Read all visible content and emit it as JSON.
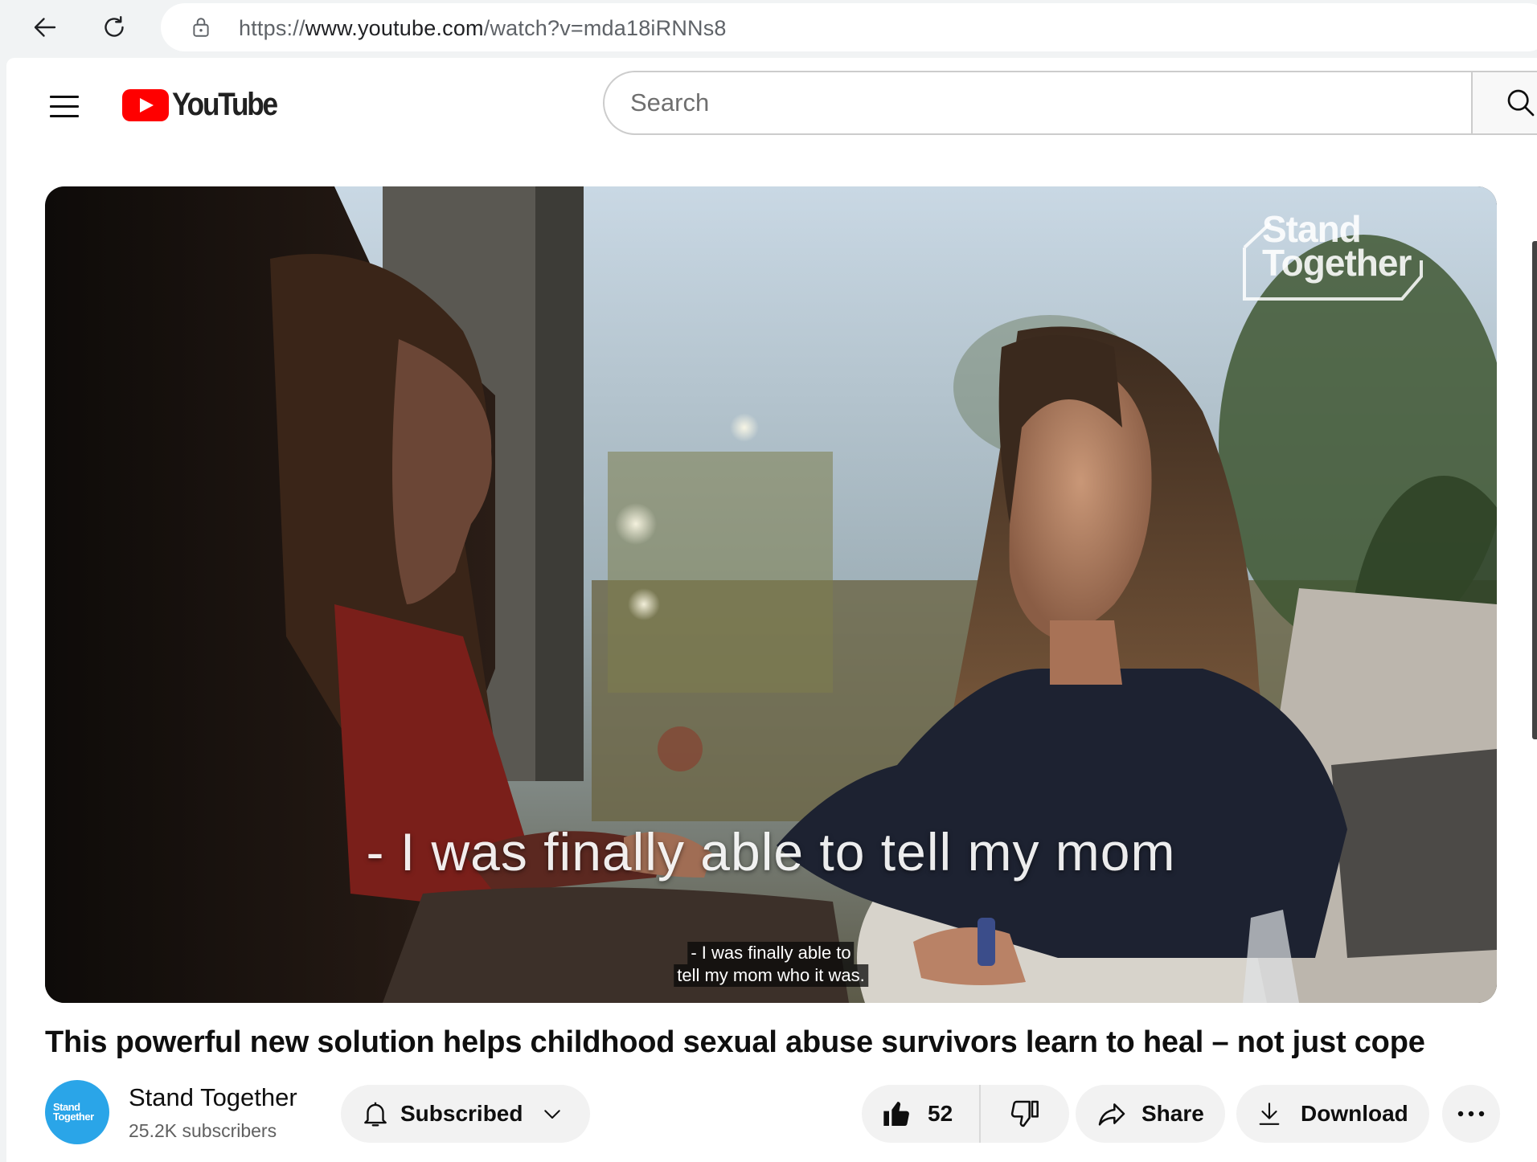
{
  "browser": {
    "url_prefix": "https://",
    "url_domain": "www.youtube.com",
    "url_path": "/watch?v=mda18iRNNs8"
  },
  "masthead": {
    "logo_text": "YouTube",
    "search_placeholder": "Search"
  },
  "video": {
    "watermark": "Stand Together",
    "burned_caption": "- I was finally able to tell my mom",
    "cc_line1": "- I was finally able to",
    "cc_line2": "tell my mom who it was."
  },
  "title": "This powerful new solution helps childhood sexual abuse survivors learn to heal – not just cope",
  "owner": {
    "avatar_line1": "Stand",
    "avatar_line2": "Together",
    "channel_name": "Stand Together",
    "subscribers": "25.2K subscribers",
    "subscribe_label": "Subscribed"
  },
  "actions": {
    "like_count": "52",
    "share_label": "Share",
    "download_label": "Download"
  },
  "icons": [
    "back-arrow-icon",
    "reload-icon",
    "lock-icon",
    "hamburger-menu-icon",
    "search-icon",
    "bell-icon",
    "chevron-down-icon",
    "thumbs-up-icon",
    "thumbs-down-icon",
    "share-arrow-icon",
    "download-icon",
    "more-dots-icon"
  ],
  "colors": {
    "brand_red": "#ff0000",
    "avatar_blue": "#2aa5e8",
    "pill_bg": "#f2f2f2"
  }
}
